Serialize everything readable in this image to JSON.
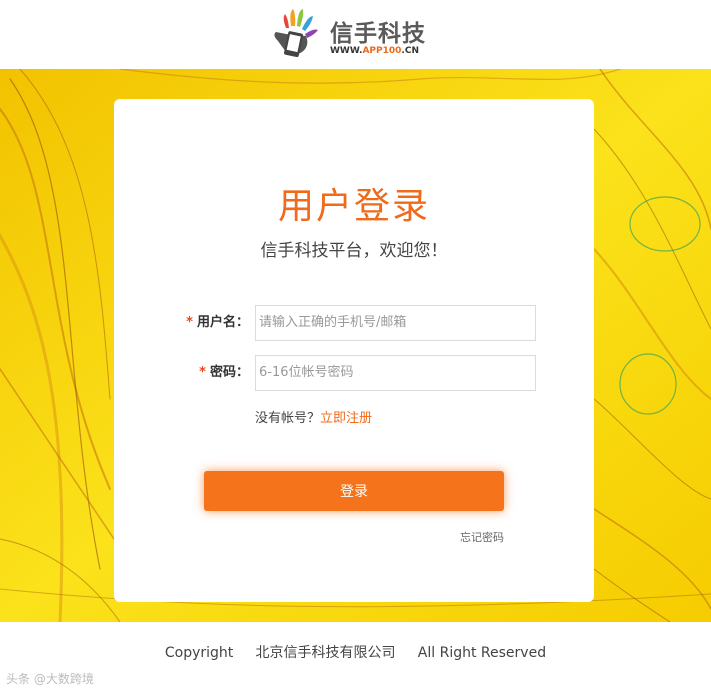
{
  "header": {
    "logo_name": "信手科技",
    "logo_url_prefix": "WWW.",
    "logo_url_highlight": "APP100",
    "logo_url_suffix": ".CN"
  },
  "login": {
    "title": "用户登录",
    "subtitle": "信手科技平台，欢迎您！",
    "username_label": "用户名：",
    "username_placeholder": "请输入正确的手机号/邮箱",
    "password_label": "密码：",
    "password_placeholder": "6-16位帐号密码",
    "required_mark": "*",
    "no_account_text": "没有帐号？",
    "register_link": "立即注册",
    "login_button": "登录",
    "forgot_link": "忘记密码"
  },
  "footer": {
    "copyright": "Copyright     北京信手科技有限公司     All Right Reserved",
    "watermark": "头条 @大数跨境"
  },
  "colors": {
    "accent": "#f06a1a",
    "button": "#f5731a",
    "background": "#f7d400"
  },
  "icons": [
    "hand-phone-logo-icon"
  ]
}
